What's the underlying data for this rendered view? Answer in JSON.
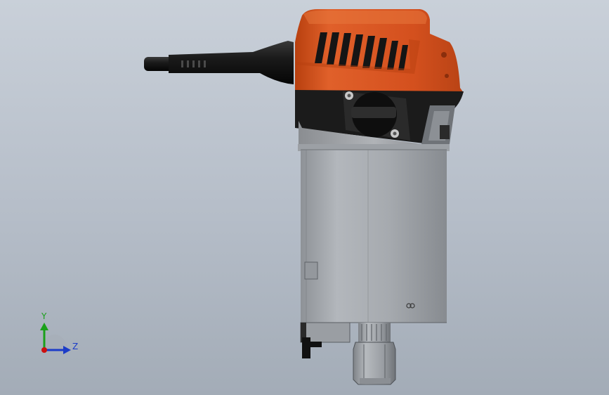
{
  "viewport": {
    "model": "router-assembly",
    "colors": {
      "housing_orange": "#d4501e",
      "housing_black": "#1a1a1a",
      "motor_gray": "#a7abb0",
      "collet_gray": "#9a9ea3",
      "background_top": "#c9d0d9",
      "background_bottom": "#a3acb7"
    }
  },
  "triad": {
    "y_label": "Y",
    "z_label": "Z",
    "y_color": "#1aa01a",
    "z_color": "#1c3cc8",
    "origin_color": "#cc1010"
  }
}
